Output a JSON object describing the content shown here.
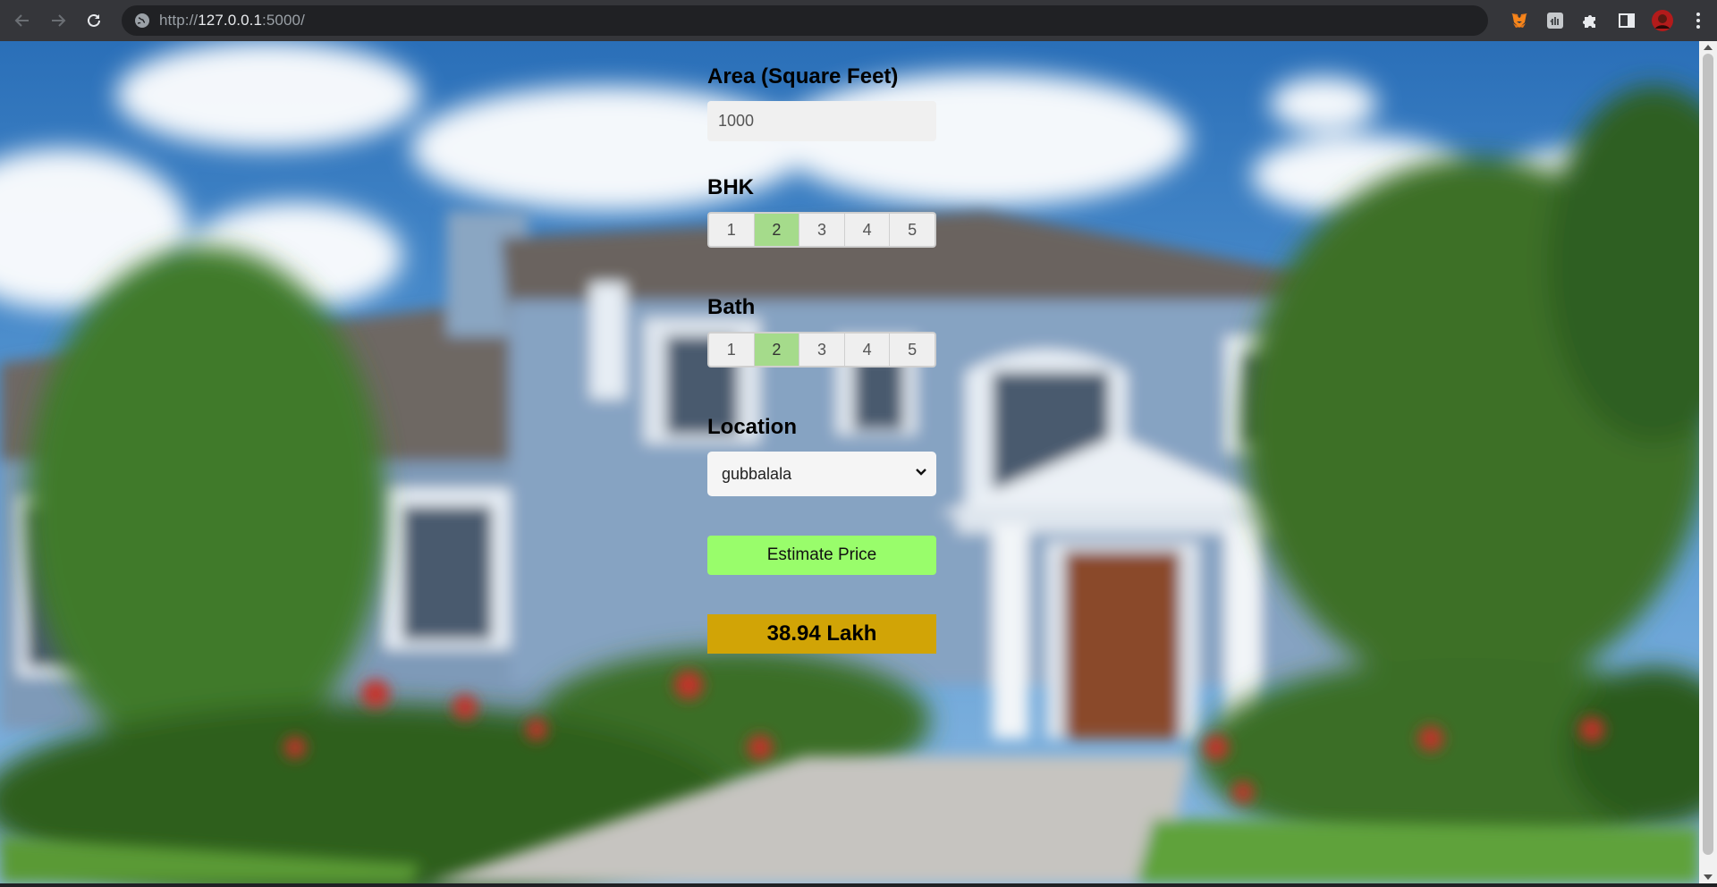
{
  "browser": {
    "url_scheme": "http://",
    "url_host": "127.0.0.1",
    "url_rest": ":5000/",
    "icons": {
      "back": "arrow-left-icon",
      "forward": "arrow-right-icon",
      "reload": "reload-icon",
      "site_info": "globe-icon",
      "ext1": "metamask-fox-icon",
      "ext2": "hand-extension-icon",
      "ext3": "puzzle-extensions-icon",
      "side_panel": "side-panel-icon",
      "profile": "profile-avatar",
      "menu": "kebab-menu-icon"
    }
  },
  "form": {
    "area_label": "Area (Square Feet)",
    "area_value": "1000",
    "bhk_label": "BHK",
    "bhk_options": [
      "1",
      "2",
      "3",
      "4",
      "5"
    ],
    "bhk_selected": "2",
    "bath_label": "Bath",
    "bath_options": [
      "1",
      "2",
      "3",
      "4",
      "5"
    ],
    "bath_selected": "2",
    "location_label": "Location",
    "location_value": "gubbalala",
    "button_label": "Estimate Price",
    "result_text": "38.94 Lakh"
  },
  "colors": {
    "selected_option": "#a5db8b",
    "button": "#99fd6b",
    "result_bg": "#d1a406"
  }
}
